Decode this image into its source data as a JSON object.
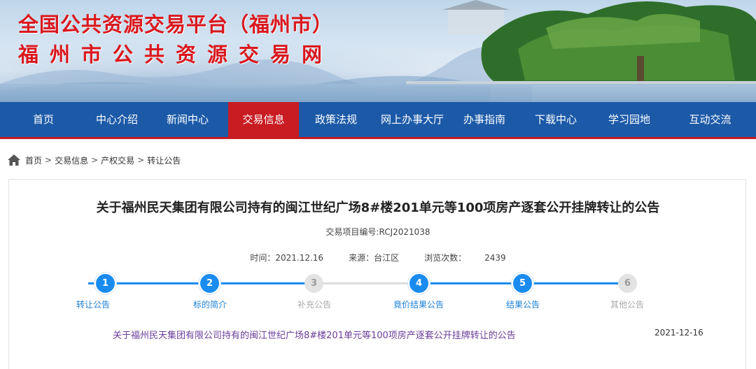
{
  "header": {
    "title_line1": "全国公共资源交易平台（福州市）",
    "title_line2": "福州市公共资源交易网"
  },
  "nav": {
    "items": [
      {
        "label": "首页",
        "active": false
      },
      {
        "label": "中心介绍",
        "active": false
      },
      {
        "label": "新闻中心",
        "active": false
      },
      {
        "label": "交易信息",
        "active": true
      },
      {
        "label": "政策法规",
        "active": false
      },
      {
        "label": "网上办事大厅",
        "active": false
      },
      {
        "label": "办事指南",
        "active": false
      },
      {
        "label": "下载中心",
        "active": false
      },
      {
        "label": "学习园地",
        "active": false
      },
      {
        "label": "互动交流",
        "active": false
      }
    ],
    "accent_color": "#1c5aa8",
    "active_color": "#c81c22"
  },
  "breadcrumb": {
    "items": [
      "首页",
      "交易信息",
      "产权交易",
      "转让公告"
    ],
    "separator": ">"
  },
  "article": {
    "title": "关于福州民天集团有限公司持有的闽江世纪广场8#楼201单元等100项房产逐套公开挂牌转让的公告",
    "project_code": "交易项目编号:RCJ2021038",
    "time_label": "时间：2021.12.16",
    "source_label": "来源：台江区",
    "views_label": "浏览次数：",
    "views_value": "2439"
  },
  "steps": [
    {
      "number": "1",
      "label": "转让公告",
      "active": true
    },
    {
      "number": "2",
      "label": "标的简介",
      "active": true
    },
    {
      "number": "3",
      "label": "补充公告",
      "active": false
    },
    {
      "number": "4",
      "label": "竟价结果公告",
      "active": true
    },
    {
      "number": "5",
      "label": "结果公告",
      "active": true
    },
    {
      "number": "6",
      "label": "其他公告",
      "active": false
    }
  ],
  "announcement": {
    "link_text": "关于福州民天集团有限公司持有的闽江世纪广场8#楼201单元等100项房产逐套公开挂牌转让的公告",
    "date": "2021-12-16"
  }
}
